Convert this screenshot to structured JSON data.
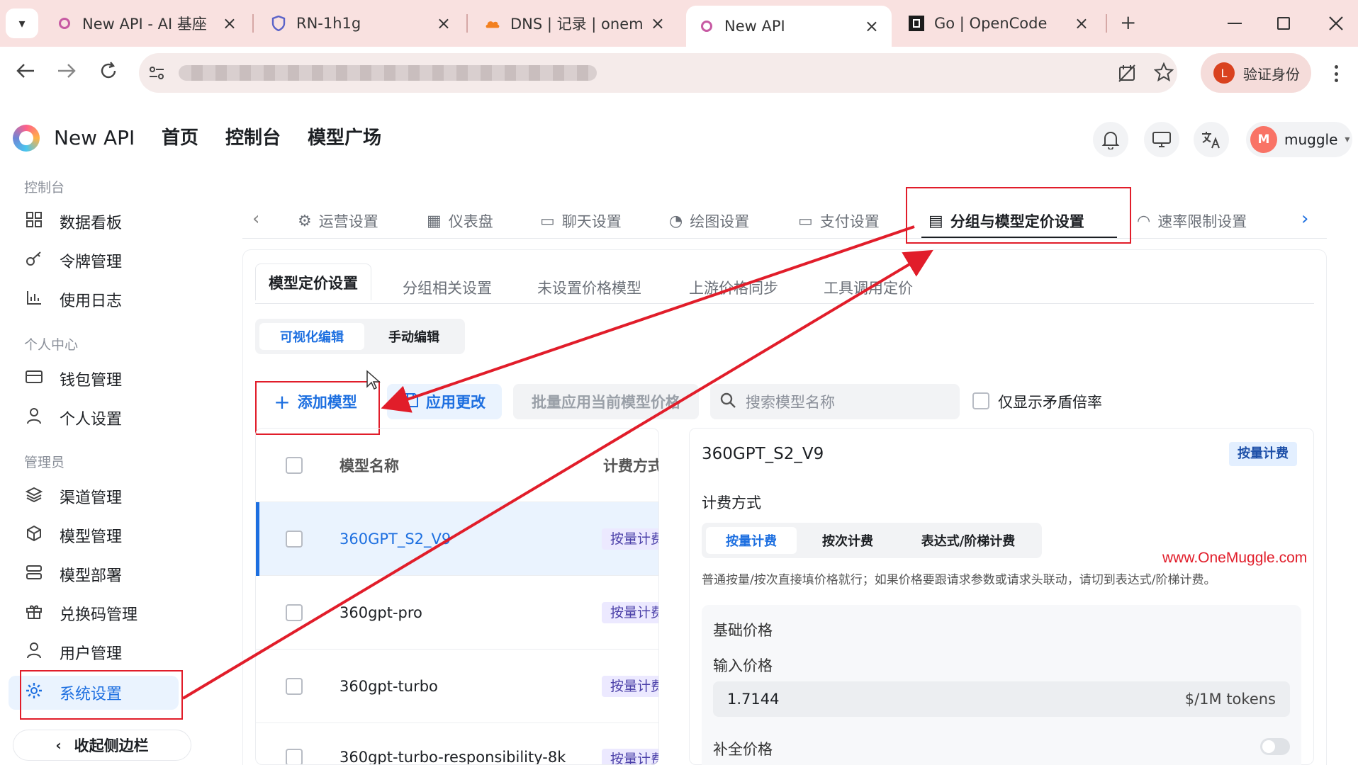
{
  "browser": {
    "tabs": [
      {
        "title": "New API - AI 基座",
        "favicon": "newapi-icon"
      },
      {
        "title": "RN-1h1g",
        "favicon": "shield-icon"
      },
      {
        "title": "DNS | 记录 | onemuc",
        "favicon": "cloud-icon"
      },
      {
        "title": "New API",
        "favicon": "newapi-icon"
      },
      {
        "title": "Go | OpenCode",
        "favicon": "opencode-icon"
      }
    ],
    "close_glyph": "×",
    "new_tab_glyph": "+",
    "verify_label": "验证身份",
    "verify_avatar": "L"
  },
  "app": {
    "brand": "New API",
    "nav": [
      "首页",
      "控制台",
      "模型广场"
    ],
    "user_initial": "M",
    "username": "muggle"
  },
  "sidebar": {
    "sections": [
      {
        "title": "控制台",
        "items": [
          {
            "label": "数据看板",
            "icon": "dashboard-icon"
          },
          {
            "label": "令牌管理",
            "icon": "key-icon"
          },
          {
            "label": "使用日志",
            "icon": "chart-icon"
          }
        ]
      },
      {
        "title": "个人中心",
        "items": [
          {
            "label": "钱包管理",
            "icon": "wallet-icon"
          },
          {
            "label": "个人设置",
            "icon": "user-icon"
          }
        ]
      },
      {
        "title": "管理员",
        "items": [
          {
            "label": "渠道管理",
            "icon": "layers-icon"
          },
          {
            "label": "模型管理",
            "icon": "cube-icon"
          },
          {
            "label": "模型部署",
            "icon": "server-icon"
          },
          {
            "label": "兑换码管理",
            "icon": "gift-icon"
          },
          {
            "label": "用户管理",
            "icon": "user-icon"
          },
          {
            "label": "系统设置",
            "icon": "gear-icon"
          }
        ]
      }
    ],
    "collapse_label": "收起侧边栏"
  },
  "settings_tabs": [
    "运营设置",
    "仪表盘",
    "聊天设置",
    "绘图设置",
    "支付设置",
    "分组与模型定价设置",
    "速率限制设置"
  ],
  "sub_tabs": [
    "模型定价设置",
    "分组相关设置",
    "未设置价格模型",
    "上游价格同步",
    "工具调用定价"
  ],
  "edit_modes": [
    "可视化编辑",
    "手动编辑"
  ],
  "toolbar": {
    "add_model": "添加模型",
    "apply_changes": "应用更改",
    "batch_apply": "批量应用当前模型价格",
    "search_placeholder": "搜索模型名称",
    "conflict_only": "仅显示矛盾倍率"
  },
  "table": {
    "headers": [
      "模型名称",
      "计费方式"
    ],
    "rows": [
      {
        "name": "360GPT_S2_V9",
        "billing": "按量计费",
        "selected": true
      },
      {
        "name": "360gpt-pro",
        "billing": "按量计费",
        "selected": false
      },
      {
        "name": "360gpt-turbo",
        "billing": "按量计费",
        "selected": false
      },
      {
        "name": "360gpt-turbo-responsibility-8k",
        "billing": "按量计费",
        "selected": false
      }
    ]
  },
  "detail": {
    "model_name": "360GPT_S2_V9",
    "billing_badge": "按量计费",
    "billing_label": "计费方式",
    "billing_options": [
      "按量计费",
      "按次计费",
      "表达式/阶梯计费"
    ],
    "hint": "普通按量/按次直接填价格就行；如果价格要跟请求参数或请求头联动，请切到表达式/阶梯计费。",
    "base_price_title": "基础价格",
    "input_price_label": "输入价格",
    "input_price_value": "1.7144",
    "input_price_unit": "$/1M tokens",
    "completion_price_label": "补全价格"
  },
  "watermark": "www.OneMuggle.com",
  "colors": {
    "accent": "#1d6fe0",
    "annotation": "#e11d2a"
  }
}
